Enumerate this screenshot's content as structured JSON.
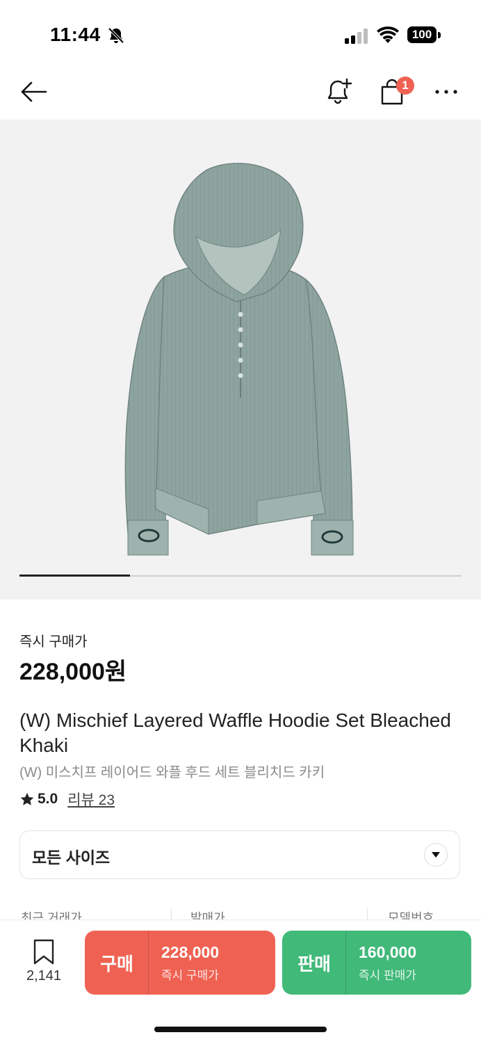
{
  "status_bar": {
    "time": "11:44",
    "battery": "100"
  },
  "header": {
    "cart_badge": "1"
  },
  "gallery": {
    "progress": 0.25
  },
  "product": {
    "price_label": "즉시 구매가",
    "price": "228,000원",
    "title": "(W) Mischief Layered Waffle Hoodie Set Bleached Khaki",
    "title_kr": "(W) 미스치프 레이어드 와플 후드 세트 블리치드 카키",
    "rating": "5.0",
    "reviews": "리뷰 23"
  },
  "size_selector": {
    "label": "모든 사이즈"
  },
  "info_row": [
    "최근 거래가",
    "발매가",
    "모델번호"
  ],
  "bottom_bar": {
    "bookmark_count": "2,141",
    "buy": {
      "label": "구매",
      "price": "228,000",
      "sub": "즉시 구매가"
    },
    "sell": {
      "label": "판매",
      "price": "160,000",
      "sub": "즉시 판매가"
    }
  },
  "colors": {
    "buy": "#ef6253",
    "sell": "#41b979",
    "badge": "#ef6253"
  }
}
